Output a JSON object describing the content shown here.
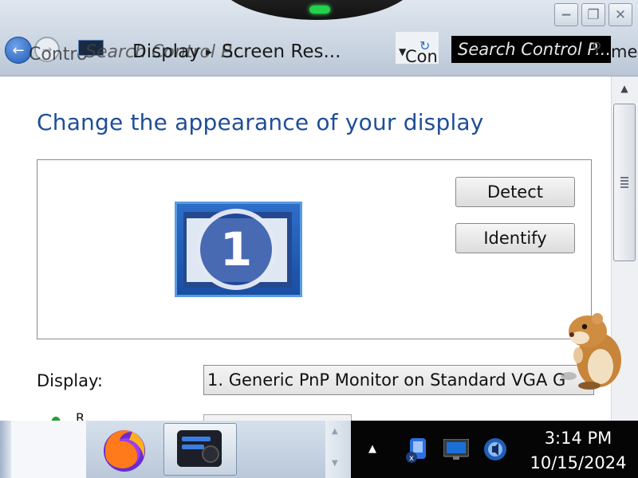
{
  "window": {
    "title_chrome": {
      "minimize_glyph": "−",
      "maximize_glyph": "❐",
      "close_glyph": "✕"
    },
    "nav": {
      "back_icon": "back-arrow-icon",
      "forward_icon": "forward-arrow-icon"
    },
    "address_bar": {
      "ghost_text_left": "Contro",
      "ghost_search_hint": "Search Control P...",
      "breadcrumb_display": "Display",
      "breadcrumb_screen": "Screen Res...",
      "ghost_con": "Con",
      "search_text": "Search Control P...",
      "ghost_right": "me"
    }
  },
  "main": {
    "title": "Change the appearance of your display",
    "monitor_number": "1",
    "detect_label": "Detect",
    "identify_label": "Identify",
    "display_label": "Display:",
    "display_value": "1. Generic PnP Monitor on Standard VGA G",
    "next_row_letter": "R"
  },
  "taskbar": {
    "apps": [
      "firefox",
      "obs-studio"
    ],
    "tray_icons": [
      "network-icon",
      "display-icon",
      "volume-icon"
    ],
    "time": "3:14 PM",
    "date": "10/15/2024"
  },
  "colors": {
    "title_blue": "#1f4e96",
    "taskbar_bg": "#050505",
    "chrome_bg": "#c7d2df"
  }
}
